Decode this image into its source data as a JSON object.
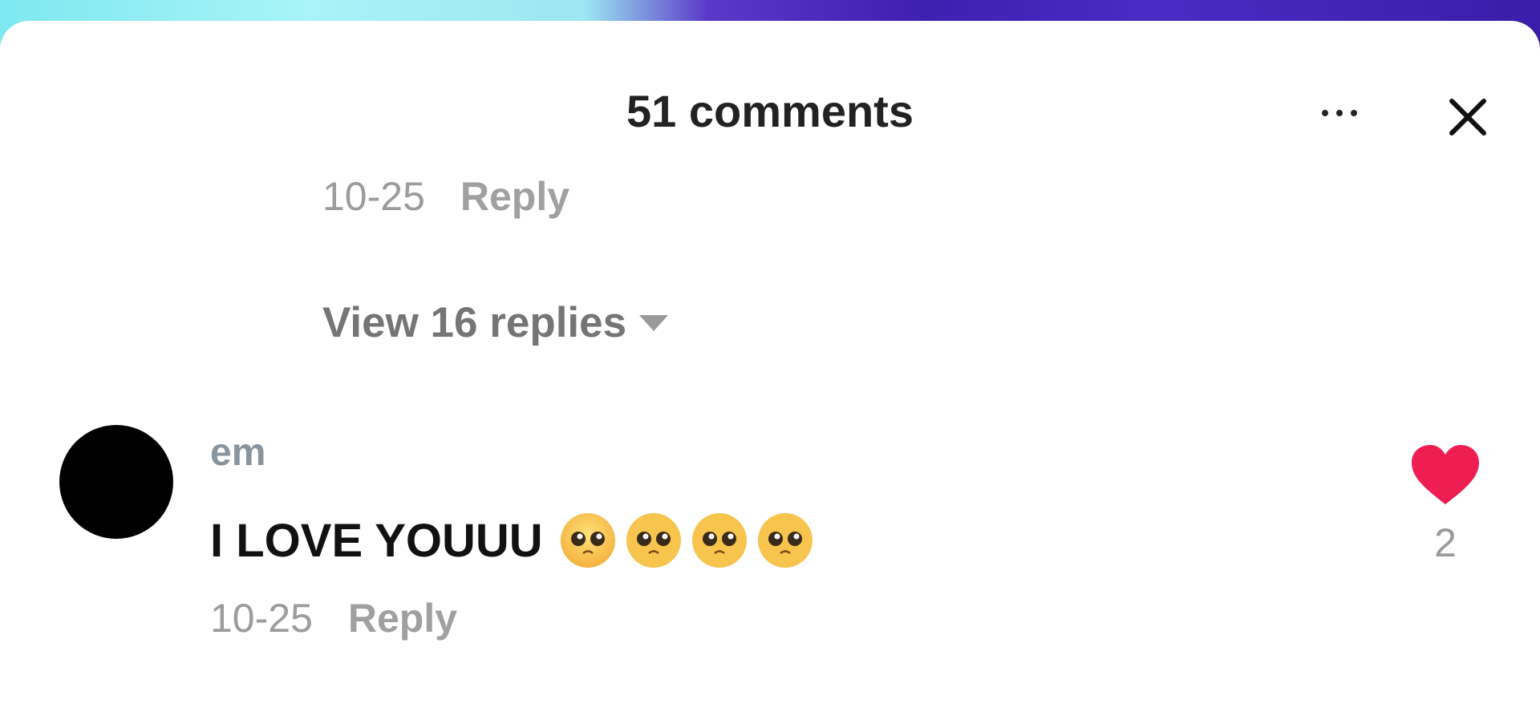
{
  "header": {
    "title": "51 comments",
    "more_icon": "more-horizontal-icon",
    "close_icon": "close-icon"
  },
  "prev_comment": {
    "date": "10-25",
    "reply_label": "Reply"
  },
  "view_replies": {
    "label": "View 16 replies",
    "icon": "caret-down-icon"
  },
  "comment": {
    "username": "em",
    "text": "I LOVE YOUUU",
    "emojis": [
      "pleading-face-emoji",
      "pleading-face-emoji",
      "pleading-face-emoji",
      "pleading-face-emoji"
    ],
    "date": "10-25",
    "reply_label": "Reply",
    "like_count": "2",
    "like_icon": "heart-icon",
    "like_color": "#ee1d52"
  },
  "colors": {
    "accent_like": "#ee1d52",
    "title": "#222222",
    "meta_gray": "#9a9a9a",
    "avatar": "#000000"
  }
}
